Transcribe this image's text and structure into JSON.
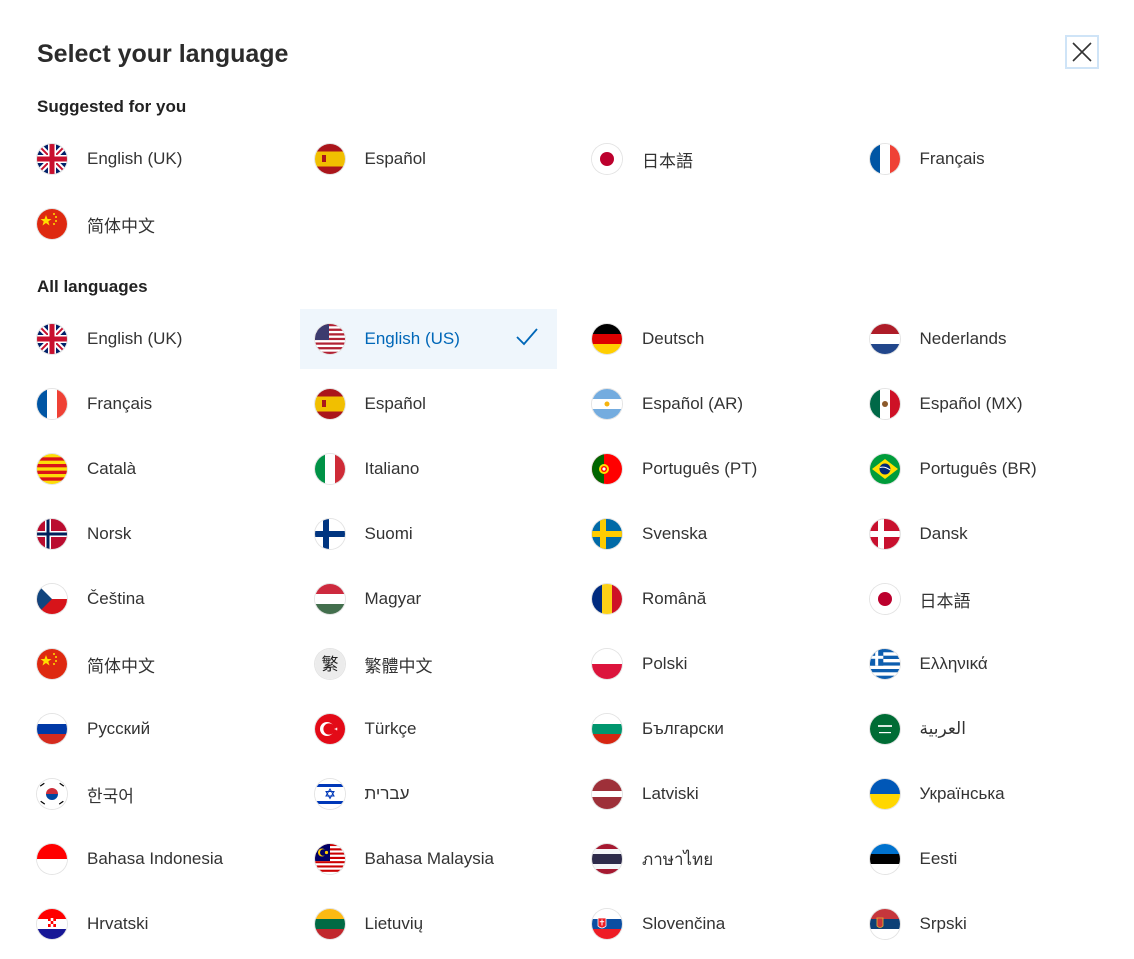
{
  "dialog": {
    "title": "Select your language",
    "close_icon": "close-icon"
  },
  "suggested": {
    "heading": "Suggested for you",
    "items": [
      {
        "label": "English (UK)",
        "flag": "uk"
      },
      {
        "label": "Español",
        "flag": "es"
      },
      {
        "label": "日本語",
        "flag": "jp"
      },
      {
        "label": "Français",
        "flag": "fr"
      },
      {
        "label": "简体中文",
        "flag": "cn"
      }
    ]
  },
  "all": {
    "heading": "All languages",
    "items": [
      {
        "label": "English (UK)",
        "flag": "uk"
      },
      {
        "label": "English (US)",
        "flag": "us",
        "selected": true
      },
      {
        "label": "Deutsch",
        "flag": "de"
      },
      {
        "label": "Nederlands",
        "flag": "nl"
      },
      {
        "label": "Français",
        "flag": "fr"
      },
      {
        "label": "Español",
        "flag": "es"
      },
      {
        "label": "Español (AR)",
        "flag": "ar"
      },
      {
        "label": "Español (MX)",
        "flag": "mx"
      },
      {
        "label": "Català",
        "flag": "cat"
      },
      {
        "label": "Italiano",
        "flag": "it"
      },
      {
        "label": "Português (PT)",
        "flag": "pt"
      },
      {
        "label": "Português (BR)",
        "flag": "br"
      },
      {
        "label": "Norsk",
        "flag": "no"
      },
      {
        "label": "Suomi",
        "flag": "fi"
      },
      {
        "label": "Svenska",
        "flag": "se"
      },
      {
        "label": "Dansk",
        "flag": "dk"
      },
      {
        "label": "Čeština",
        "flag": "cz"
      },
      {
        "label": "Magyar",
        "flag": "hu"
      },
      {
        "label": "Română",
        "flag": "ro"
      },
      {
        "label": "日本語",
        "flag": "jp"
      },
      {
        "label": "简体中文",
        "flag": "cn"
      },
      {
        "label": "繁體中文",
        "flag": "tw",
        "flag_glyph": "繁"
      },
      {
        "label": "Polski",
        "flag": "pl"
      },
      {
        "label": "Ελληνικά",
        "flag": "gr"
      },
      {
        "label": "Русский",
        "flag": "ru"
      },
      {
        "label": "Türkçe",
        "flag": "tr"
      },
      {
        "label": "Български",
        "flag": "bg"
      },
      {
        "label": "العربية",
        "flag": "sa"
      },
      {
        "label": "한국어",
        "flag": "kr"
      },
      {
        "label": "עברית",
        "flag": "il"
      },
      {
        "label": "Latviski",
        "flag": "lv"
      },
      {
        "label": "Українська",
        "flag": "ua"
      },
      {
        "label": "Bahasa Indonesia",
        "flag": "id"
      },
      {
        "label": "Bahasa Malaysia",
        "flag": "my"
      },
      {
        "label": "ภาษาไทย",
        "flag": "th"
      },
      {
        "label": "Eesti",
        "flag": "ee"
      },
      {
        "label": "Hrvatski",
        "flag": "hr"
      },
      {
        "label": "Lietuvių",
        "flag": "lt"
      },
      {
        "label": "Slovenčina",
        "flag": "sk"
      },
      {
        "label": "Srpski",
        "flag": "rs"
      }
    ]
  },
  "colors": {
    "selected_bg": "#eff6fc",
    "selected_text": "#0067b8",
    "close_border": "#cfe4f7"
  }
}
